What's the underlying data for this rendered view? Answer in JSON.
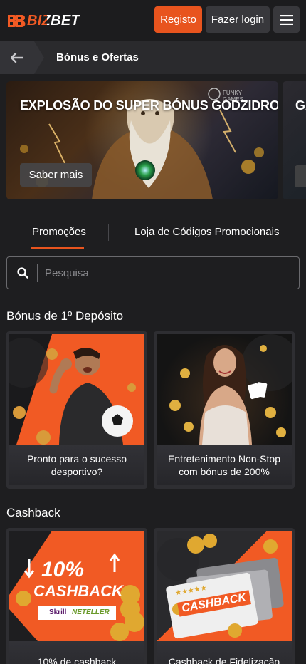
{
  "header": {
    "logo": "BIZBET",
    "register_label": "Registo",
    "login_label": "Fazer login",
    "menu_icon": "hamburger-icon"
  },
  "subheader": {
    "back_icon": "arrow-left-icon",
    "title": "Bónus e Ofertas"
  },
  "banner": {
    "title": "EXPLOSÃO DO SUPER BÓNUS GODZIDROP",
    "cta_label": "Saber mais",
    "provider": "FUNKY GAMES",
    "next_title_fragment": "GA"
  },
  "tabs": [
    {
      "label": "Promoções",
      "active": true
    },
    {
      "label": "Loja de Códigos Promocionais",
      "active": false
    }
  ],
  "search": {
    "placeholder": "Pesquisa",
    "value": ""
  },
  "sections": [
    {
      "title": "Bónus de 1º Depósito",
      "cards": [
        {
          "label": "Pronto para o sucesso desportivo?"
        },
        {
          "label": "Entretenimento Non-Stop com bónus de 200%"
        }
      ]
    },
    {
      "title": "Cashback",
      "cards": [
        {
          "label": "10% de cashback",
          "graphic_text": "10%",
          "graphic_subtext": "CASHBACK",
          "payment": [
            "Skrill",
            "NETELLER"
          ]
        },
        {
          "label": "Cashback de Fidelização",
          "graphic_text": "CASHBACK"
        }
      ]
    }
  ],
  "colors": {
    "accent": "#e8541e",
    "background": "#1e1e20",
    "card": "#2e2e32"
  }
}
